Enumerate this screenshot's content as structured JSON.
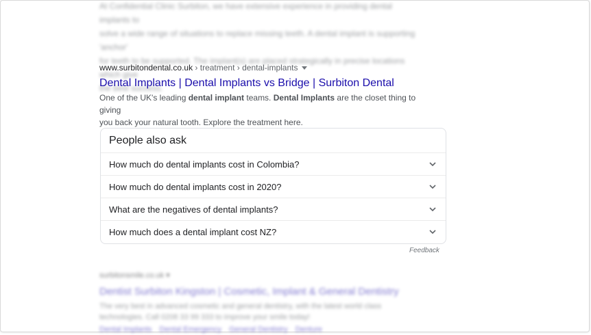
{
  "top_result": {
    "snippet_lines": [
      "At Confidential Clinic Surbiton, we have extensive experience in providing dental implants to",
      "solve a wide range of situations to replace missing teeth. A dental implant is supporting 'anchor'",
      "for teeth to be supported. The implant(s) are placed strategically in precise locations which give",
      "the best success."
    ]
  },
  "result": {
    "domain": "www.surbitondental.co.uk",
    "breadcrumbs": " › treatment › dental-implants",
    "title": "Dental Implants | Dental Implants vs Bridge | Surbiton Dental",
    "snippet": {
      "part1": "One of the UK's leading ",
      "bold1": "dental implant",
      "part2": " teams. ",
      "bold2": "Dental Implants",
      "part3": " are the closet thing to giving",
      "line2": "you back your natural tooth. Explore the treatment here."
    }
  },
  "people_also_ask": {
    "title": "People also ask",
    "questions": [
      "How much do dental implants cost in Colombia?",
      "How much do dental implants cost in 2020?",
      "What are the negatives of dental implants?",
      "How much does a dental implant cost NZ?"
    ],
    "feedback": "Feedback"
  },
  "next_result": {
    "domain": "surbitonsmile.co.uk",
    "title": "Dentist Surbiton Kingston | Cosmetic, Implant & General Dentistry",
    "snippet_lines": [
      "The very best in advanced cosmetic and general dentistry, with the latest world class",
      "technologies. Call 0208 33 99 333 to improve your smile today!"
    ],
    "sitelinks": [
      "Dental Implants",
      "Dental Emergency",
      "General Dentistry",
      "Denture"
    ]
  },
  "colors": {
    "link": "#1a0dab",
    "text": "#202124",
    "snippet": "#4d5156",
    "border": "#dfe1e5"
  }
}
